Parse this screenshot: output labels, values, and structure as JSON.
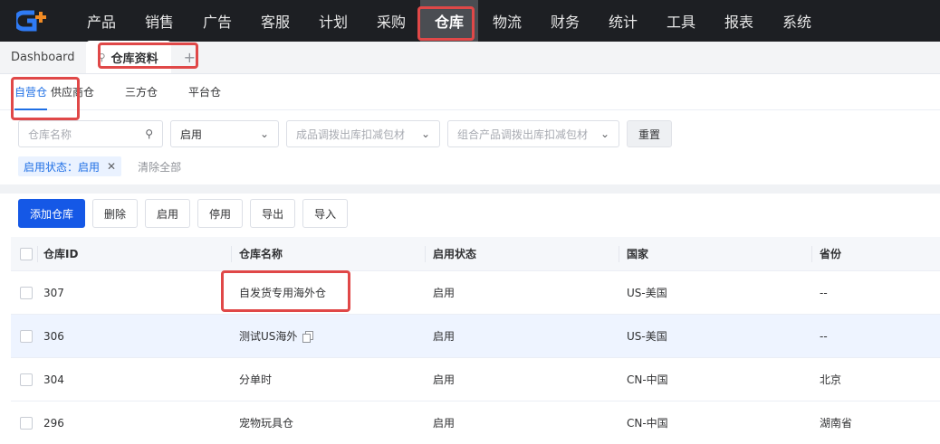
{
  "nav": {
    "logo_text": "G",
    "items": [
      "产品",
      "销售",
      "广告",
      "客服",
      "计划",
      "采购",
      "仓库",
      "物流",
      "财务",
      "统计",
      "工具",
      "报表",
      "系统"
    ],
    "active_index": 6
  },
  "tabs": {
    "dashboard": "Dashboard",
    "current": "仓库资料",
    "add": "+"
  },
  "subtabs": [
    "自营仓",
    "供应商仓",
    "三方仓",
    "平台仓"
  ],
  "filters": {
    "name_placeholder": "仓库名称",
    "status_value": "启用",
    "product_transfer_placeholder": "成品调拨出库扣减包材",
    "combo_transfer_placeholder": "组合产品调拨出库扣减包材",
    "reset": "重置"
  },
  "chips": {
    "status_chip": "启用状态：启用",
    "clear_all": "清除全部"
  },
  "actions": {
    "add": "添加仓库",
    "delete": "删除",
    "enable": "启用",
    "disable": "停用",
    "export": "导出",
    "import": "导入"
  },
  "table": {
    "headers": [
      "仓库ID",
      "仓库名称",
      "启用状态",
      "国家",
      "省份"
    ],
    "rows": [
      {
        "id": "307",
        "name": "自发货专用海外仓",
        "status": "启用",
        "country": "US-美国",
        "province": "--"
      },
      {
        "id": "306",
        "name": "测试US海外",
        "status": "启用",
        "country": "US-美国",
        "province": "--"
      },
      {
        "id": "304",
        "name": "分单时",
        "status": "启用",
        "country": "CN-中国",
        "province": "北京"
      },
      {
        "id": "296",
        "name": "宠物玩具仓",
        "status": "启用",
        "country": "CN-中国",
        "province": "湖南省"
      }
    ]
  },
  "colors": {
    "primary": "#1558e6",
    "nav_bg": "#1d1f23",
    "annotation": "#e04848"
  }
}
